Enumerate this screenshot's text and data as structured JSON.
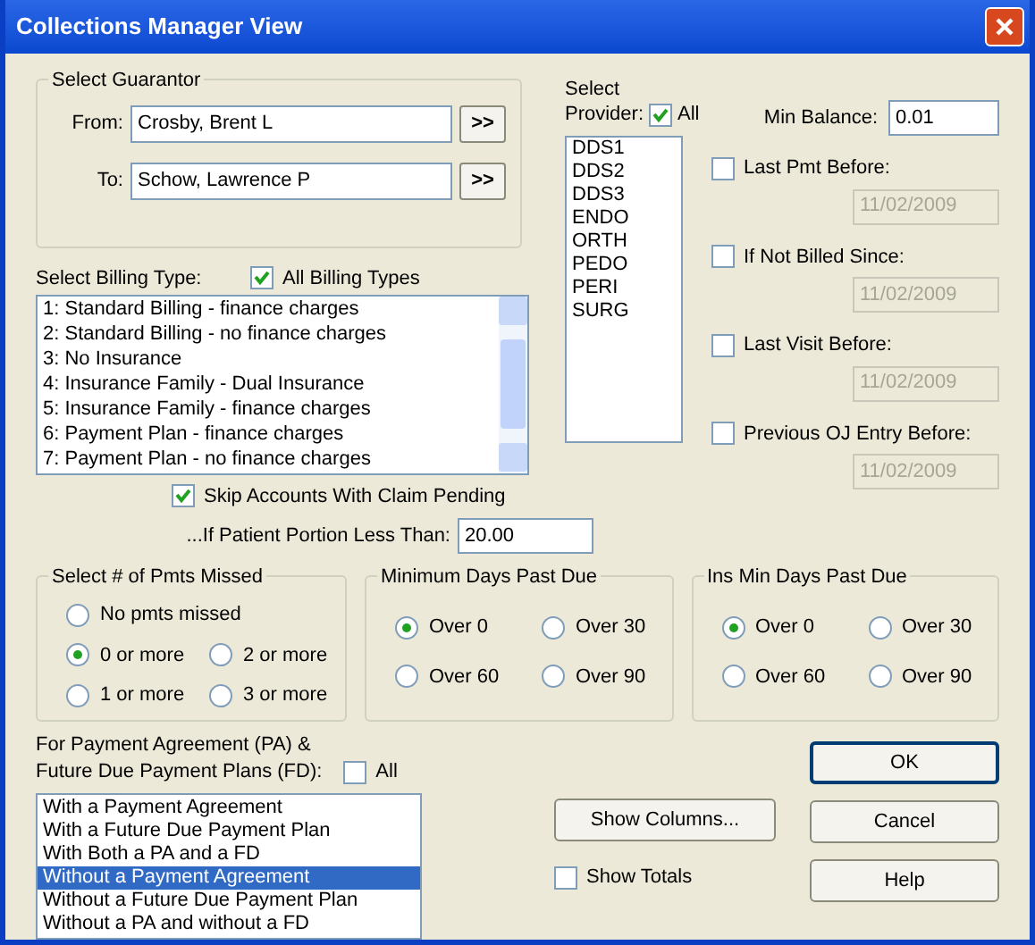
{
  "window": {
    "title": "Collections Manager View"
  },
  "guarantor": {
    "title": "Select Guarantor",
    "fields": [
      {
        "label": "From:",
        "value": "Crosby, Brent L",
        "button": ">>"
      },
      {
        "label": "To:",
        "value": "Schow, Lawrence P",
        "button": ">>"
      }
    ]
  },
  "billing": {
    "label": "Select Billing Type:",
    "all": {
      "label": "All Billing Types",
      "checked": true
    },
    "items": [
      "1: Standard Billing - finance charges",
      "2: Standard Billing - no finance charges",
      "3: No Insurance",
      "4: Insurance Family - Dual Insurance",
      "5: Insurance Family - finance charges",
      "6: Payment Plan - finance charges",
      "7: Payment Plan - no finance charges"
    ]
  },
  "skip_claim": {
    "label": "Skip Accounts With Claim Pending",
    "checked": true
  },
  "patient_portion": {
    "label": "...If Patient Portion Less Than:",
    "value": "20.00"
  },
  "provider": {
    "label_top": "Select",
    "label": "Provider:",
    "all": {
      "label": "All",
      "checked": true
    },
    "items": [
      "DDS1",
      "DDS2",
      "DDS3",
      "ENDO",
      "ORTH",
      "PEDO",
      "PERI",
      "SURG"
    ]
  },
  "min_balance": {
    "label": "Min Balance:",
    "value": "0.01"
  },
  "date_filters": [
    {
      "label": "Last Pmt Before:",
      "checked": false,
      "value": "11/02/2009"
    },
    {
      "label": "If Not Billed Since:",
      "checked": false,
      "value": "11/02/2009"
    },
    {
      "label": "Last Visit Before:",
      "checked": false,
      "value": "11/02/2009"
    },
    {
      "label": "Previous OJ Entry Before:",
      "checked": false,
      "value": "11/02/2009"
    }
  ],
  "groups": [
    {
      "title": "Select # of Pmts Missed",
      "options": [
        {
          "label": "No pmts missed",
          "selected": false
        },
        {
          "label": "0 or more",
          "selected": true
        },
        {
          "label": "2 or more",
          "selected": false
        },
        {
          "label": "1 or more",
          "selected": false
        },
        {
          "label": "3 or more",
          "selected": false
        }
      ]
    },
    {
      "title": "Minimum Days Past Due",
      "options": [
        {
          "label": "Over 0",
          "selected": true
        },
        {
          "label": "Over 30",
          "selected": false
        },
        {
          "label": "Over 60",
          "selected": false
        },
        {
          "label": "Over 90",
          "selected": false
        }
      ]
    },
    {
      "title": "Ins Min Days Past Due",
      "options": [
        {
          "label": "Over 0",
          "selected": true
        },
        {
          "label": "Over 30",
          "selected": false
        },
        {
          "label": "Over 60",
          "selected": false
        },
        {
          "label": "Over 90",
          "selected": false
        }
      ]
    }
  ],
  "payment_plans": {
    "label_lines": [
      "For Payment Agreement (PA) &",
      "Future Due Payment Plans (FD):"
    ],
    "all": {
      "label": "All",
      "checked": false
    },
    "items": [
      {
        "label": "With a Payment Agreement",
        "selected": false
      },
      {
        "label": "With a Future Due Payment Plan",
        "selected": false
      },
      {
        "label": "With Both a PA and a FD",
        "selected": false
      },
      {
        "label": "Without a Payment Agreement",
        "selected": true
      },
      {
        "label": "Without a Future Due Payment Plan",
        "selected": false
      },
      {
        "label": "Without a PA and without a FD",
        "selected": false
      }
    ]
  },
  "show_columns": "Show Columns...",
  "show_totals": {
    "label": "Show Totals",
    "checked": false
  },
  "buttons": [
    {
      "label": "OK",
      "default": true
    },
    {
      "label": "Cancel",
      "default": false
    },
    {
      "label": "Help",
      "default": false
    }
  ]
}
